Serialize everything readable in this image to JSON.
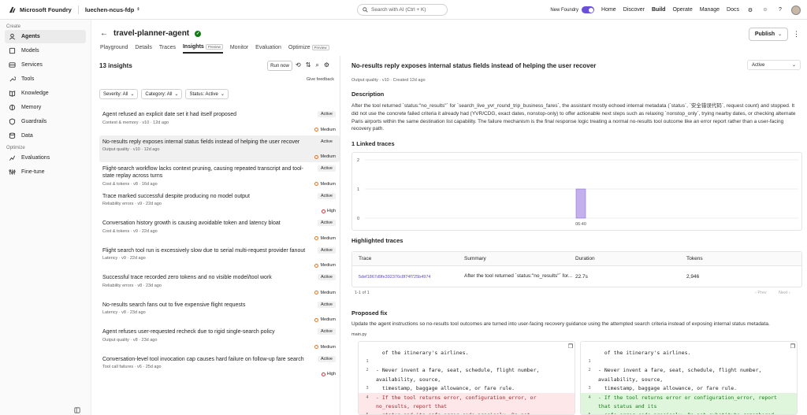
{
  "topbar": {
    "brand": "Microsoft Foundry",
    "project": "luechen-ncus-fdp",
    "search_placeholder": "Search with AI (Ctrl + K)",
    "new_foundry": "New Foundry",
    "nav": [
      "Home",
      "Discover",
      "Build",
      "Operate",
      "Manage",
      "Docs"
    ],
    "active_nav": "Build"
  },
  "sidebar": {
    "create_label": "Create",
    "create_items": [
      "Agents",
      "Models",
      "Services",
      "Tools",
      "Knowledge",
      "Memory",
      "Guardrails",
      "Data"
    ],
    "optimize_label": "Optimize",
    "optimize_items": [
      "Evaluations",
      "Fine-tune"
    ],
    "active_item": "Agents"
  },
  "header": {
    "agent_name": "travel-planner-agent",
    "publish": "Publish",
    "tabs": [
      {
        "label": "Playground"
      },
      {
        "label": "Details"
      },
      {
        "label": "Traces"
      },
      {
        "label": "Insights",
        "badge": "Preview"
      },
      {
        "label": "Monitor"
      },
      {
        "label": "Evaluation"
      },
      {
        "label": "Optimize",
        "badge": "Preview"
      }
    ]
  },
  "insights": {
    "count_title": "13 insights",
    "run_now": "Run now",
    "give_feedback": "Give feedback",
    "filters": [
      "Severity: All",
      "Category: All",
      "Status: Active"
    ],
    "items": [
      {
        "title": "Agent refused an explicit date set it had itself proposed",
        "meta": "Context & memory · v10 · 12d ago",
        "status": "Active",
        "severity": "Medium"
      },
      {
        "title": "No-results reply exposes internal status fields instead of helping the user recover",
        "meta": "Output quality · v10 · 12d ago",
        "status": "Active",
        "severity": "Medium"
      },
      {
        "title": "Flight-search workflow lacks context pruning, causing repeated transcript and tool-state replay across turns",
        "meta": "Cost & tokens · v8 · 16d ago",
        "status": "Active",
        "severity": "Medium"
      },
      {
        "title": "Trace marked successful despite producing no model output",
        "meta": "Reliability errors · v9 · 22d ago",
        "status": "Active",
        "severity": "High"
      },
      {
        "title": "Conversation history growth is causing avoidable token and latency bloat",
        "meta": "Cost & tokens · v9 · 22d ago",
        "status": "Active",
        "severity": "Medium"
      },
      {
        "title": "Flight search tool run is excessively slow due to serial multi-request provider fanout",
        "meta": "Latency · v9 · 22d ago",
        "status": "Active",
        "severity": "Medium"
      },
      {
        "title": "Successful trace recorded zero tokens and no visible model/tool work",
        "meta": "Reliability errors · v8 · 23d ago",
        "status": "Active",
        "severity": "Medium"
      },
      {
        "title": "No-results search fans out to five expensive flight requests",
        "meta": "Latency · v8 · 23d ago",
        "status": "Active",
        "severity": "Medium"
      },
      {
        "title": "Agent refuses user-requested recheck due to rigid single-search policy",
        "meta": "Output quality · v8 · 23d ago",
        "status": "Active",
        "severity": "Medium"
      },
      {
        "title": "Conversation-level tool invocation cap causes hard failure on follow-up fare search",
        "meta": "Tool call failures · v6 · 25d ago",
        "status": "Active",
        "severity": "High"
      }
    ]
  },
  "detail": {
    "title": "No-results reply exposes internal status fields instead of helping the user recover",
    "status": "Active",
    "meta": "Output quality · v10 · Created 12d ago",
    "description_heading": "Description",
    "description": "After the tool returned `status:\"no_results\"` for `search_live_yvr_round_trip_business_fares`, the assistant mostly echoed internal metadata (`status`, `安全错误代码`, request count) and stopped. It did not use the concrete failed criteria it already had (YVR/CDG, exact dates, nonstop-only) to offer actionable next steps such as relaxing `nonstop_only`, trying nearby dates, or checking alternate Paris airports within the same destination list capability. The failure mechanism is the final response logic treating a normal no-results tool outcome like an error report rather than a user-facing recovery path.",
    "linked_heading": "1 Linked traces",
    "highlighted_heading": "Highlighted traces",
    "table_headers": [
      "Trace",
      "Summary",
      "Duration",
      "Tokens"
    ],
    "table_rows": [
      {
        "trace": "5def1867d9fe392376c8f74f725b4974",
        "summary": "After the tool returned `status:\"no_results\"` for...",
        "duration": "22.7s",
        "tokens": "2,946"
      }
    ],
    "pager_count": "1-1 of 1",
    "prev": "Prev",
    "next": "Next",
    "fix_heading": "Proposed fix",
    "fix_text": "Update the agent instructions so no-results tool outcomes are turned into user-facing recovery guidance using the attempted search criteria instead of exposing internal status metadata.",
    "file_name": "main.py"
  },
  "chart_data": {
    "type": "bar",
    "categories": [
      "06:40"
    ],
    "values": [
      1
    ],
    "ylim": [
      0,
      2
    ],
    "yticks": [
      "2",
      "1",
      "0"
    ],
    "color": "#c4b0ec"
  },
  "diff": {
    "left": [
      {
        "n": "",
        "text": "  of the itinerary's airlines.",
        "kind": "ctx"
      },
      {
        "n": "1",
        "text": "",
        "kind": "ctx"
      },
      {
        "n": "2",
        "text": "- Never invent a fare, seat, schedule, flight number,",
        "kind": "ctx"
      },
      {
        "n": "",
        "text": "availability, source,",
        "kind": "ctx"
      },
      {
        "n": "3",
        "text": "  timestamp, baggage allowance, or fare rule.",
        "kind": "ctx"
      },
      {
        "n": "4",
        "text": "- If the tool returns error, configuration_error, or",
        "kind": "del"
      },
      {
        "n": "",
        "text": "no_results, report that",
        "kind": "del"
      },
      {
        "n": "5",
        "text": "  status and its safe error code precisely. Do not",
        "kind": "del"
      }
    ],
    "right": [
      {
        "n": "",
        "text": "  of the itinerary's airlines.",
        "kind": "ctx"
      },
      {
        "n": "1",
        "text": "",
        "kind": "ctx"
      },
      {
        "n": "2",
        "text": "- Never invent a fare, seat, schedule, flight number,",
        "kind": "ctx"
      },
      {
        "n": "",
        "text": "availability, source,",
        "kind": "ctx"
      },
      {
        "n": "3",
        "text": "  timestamp, baggage allowance, or fare rule.",
        "kind": "ctx"
      },
      {
        "n": "4",
        "text": "- If the tool returns error or configuration_error, report",
        "kind": "add"
      },
      {
        "n": "",
        "text": "that status and its",
        "kind": "add"
      },
      {
        "n": "5",
        "text": "  safe error code precisely. Do not substitute remembered",
        "kind": "add"
      }
    ]
  }
}
